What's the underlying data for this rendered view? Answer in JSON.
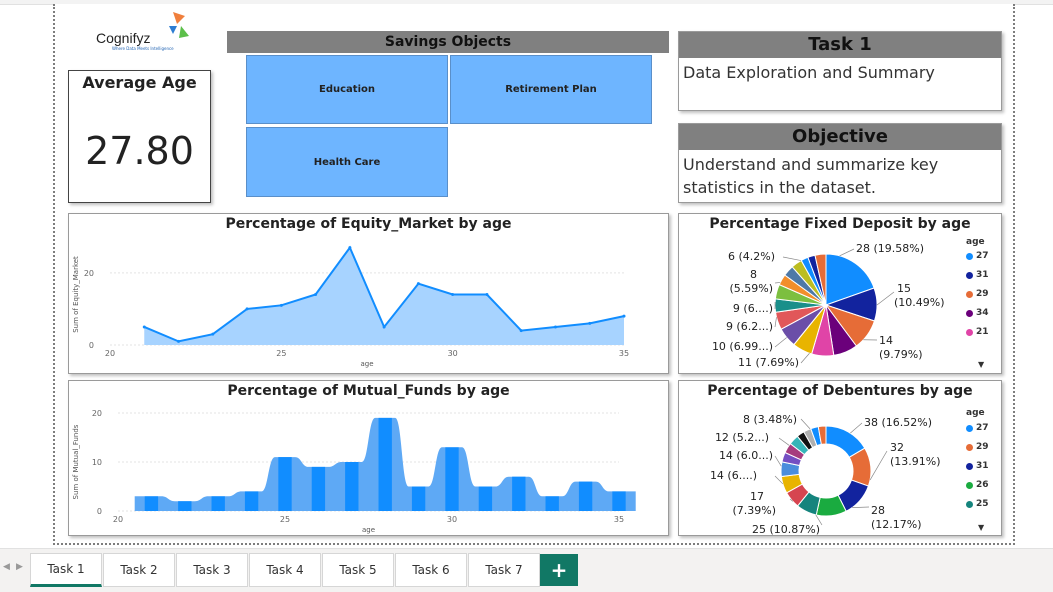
{
  "logo": {
    "name": "Cognifyz",
    "tagline": "Where Data Meets Intelligence"
  },
  "avg_card": {
    "title": "Average Age",
    "value": "27.80"
  },
  "savings": {
    "header": "Savings Objects",
    "tiles": [
      "Education",
      "Retirement Plan",
      "Health Care"
    ]
  },
  "task_card": {
    "header": "Task 1",
    "text": "Data Exploration and Summary"
  },
  "objective_card": {
    "header": "Objective",
    "text": "Understand and summarize key statistics in the dataset."
  },
  "legend_title": "age",
  "colors": {
    "blue": "#118dff",
    "navy": "#12239e",
    "orange": "#e66c37",
    "purple": "#6b007b",
    "pink": "#e044a7",
    "green": "#1aab40",
    "teal": "#15847d",
    "area": "#a7d3ff",
    "tabGreen": "#117865"
  },
  "chart_data": [
    {
      "type": "area",
      "title": "Percentage of Equity_Market by age",
      "xlabel": "age",
      "ylabel": "Sum of Equity_Market",
      "xlim": [
        20,
        35
      ],
      "ylim": [
        0,
        28
      ],
      "xticks": [
        20,
        25,
        30,
        35
      ],
      "yticks": [
        0,
        20
      ],
      "x": [
        21,
        22,
        23,
        24,
        25,
        26,
        27,
        28,
        29,
        30,
        31,
        32,
        33,
        34,
        35
      ],
      "values": [
        5,
        1,
        3,
        10,
        11,
        14,
        27,
        5,
        17,
        14,
        14,
        4,
        5,
        6,
        8
      ]
    },
    {
      "type": "bar",
      "title": "Percentage of Mutual_Funds by age",
      "xlabel": "age",
      "ylabel": "Sum of Mutual_Funds",
      "xlim": [
        20,
        35
      ],
      "ylim": [
        0,
        20
      ],
      "xticks": [
        20,
        25,
        30,
        35
      ],
      "yticks": [
        0,
        10,
        20
      ],
      "x": [
        21,
        22,
        23,
        24,
        25,
        26,
        27,
        28,
        29,
        30,
        31,
        32,
        33,
        34,
        35
      ],
      "values": [
        3,
        2,
        3,
        4,
        11,
        9,
        10,
        19,
        5,
        13,
        5,
        7,
        3,
        6,
        4
      ]
    },
    {
      "type": "pie",
      "title": "Percentage Fixed Deposit by age",
      "labels": [
        "28 (19.58%)",
        "15 (10.49%)",
        "14 (9.79%)",
        "11 (7.69%)",
        "10 (6.99...)",
        "9 (6.2...)",
        "9 (6....)",
        "8 (5.59%)",
        "6 (4.2%)"
      ],
      "values": [
        28,
        15,
        14,
        11,
        10,
        9,
        9,
        8,
        6
      ],
      "legend": [
        "27",
        "31",
        "29",
        "34",
        "21"
      ]
    },
    {
      "type": "pie",
      "title": "Percentage of Debentures by age",
      "labels": [
        "38 (16.52%)",
        "32 (13.91%)",
        "28 (12.17%)",
        "25 (10.87%)",
        "17 (7.39%)",
        "14 (6....)",
        "14 (6.0...)",
        "12 (5.2...)",
        "8 (3.48%)"
      ],
      "values": [
        38,
        32,
        28,
        25,
        17,
        14,
        14,
        12,
        8
      ],
      "legend": [
        "27",
        "29",
        "31",
        "26",
        "25"
      ]
    }
  ],
  "tabs": [
    "Task 1",
    "Task 2",
    "Task 3",
    "Task 4",
    "Task 5",
    "Task 6",
    "Task 7"
  ],
  "add_tab": "+"
}
